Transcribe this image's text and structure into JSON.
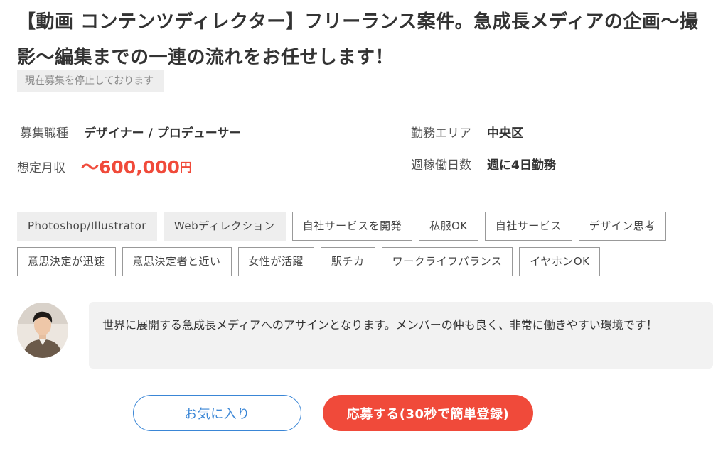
{
  "job": {
    "title": "【動画 コンテンツディレクター】フリーランス案件。急成長メディアの企画〜撮影〜編集までの一連の流れをお任せします！",
    "status": "現在募集を停止しております"
  },
  "info": {
    "role_label": "募集職種",
    "role_value": "デザイナー / プロデューサー",
    "area_label": "勤務エリア",
    "area_value": "中央区",
    "salary_label": "想定月収",
    "salary_value": "〜600,000",
    "salary_unit": "円",
    "days_label": "週稼働日数",
    "days_value": "週に4日勤務"
  },
  "tags": [
    {
      "label": "Photoshop/Illustrator",
      "style": "filled"
    },
    {
      "label": "Webディレクション",
      "style": "filled"
    },
    {
      "label": "自社サービスを開発",
      "style": "outline"
    },
    {
      "label": "私服OK",
      "style": "outline"
    },
    {
      "label": "自社サービス",
      "style": "outline"
    },
    {
      "label": "デザイン思考",
      "style": "outline"
    },
    {
      "label": "意思決定が迅速",
      "style": "outline"
    },
    {
      "label": "意思決定者と近い",
      "style": "outline"
    },
    {
      "label": "女性が活躍",
      "style": "outline"
    },
    {
      "label": "駅チカ",
      "style": "outline"
    },
    {
      "label": "ワークライフバランス",
      "style": "outline"
    },
    {
      "label": "イヤホンOK",
      "style": "outline"
    }
  ],
  "recruiter": {
    "avatar_icon": "person-photo-icon",
    "comment": "世界に展開する急成長メディアへのアサインとなります。メンバーの仲も良く、非常に働きやすい環境です！"
  },
  "actions": {
    "favorite_label": "お気に入り",
    "apply_label": "応募する(30秒で簡単登録)"
  },
  "colors": {
    "accent_red": "#f04a3a",
    "accent_blue": "#3a86d6",
    "tag_fill": "#eeeeee",
    "comment_bg": "#f2f2f2"
  }
}
